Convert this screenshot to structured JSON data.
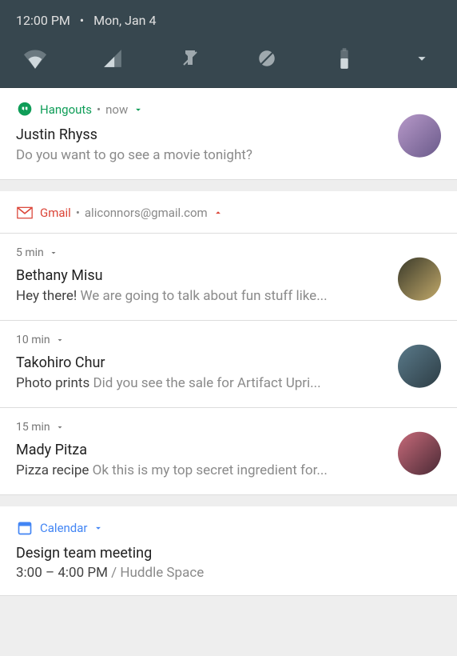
{
  "statusBar": {
    "time": "12:00 PM",
    "separator": "•",
    "date": "Mon, Jan 4"
  },
  "notifications": {
    "hangouts": {
      "appName": "Hangouts",
      "timeLabel": "now",
      "title": "Justin Rhyss",
      "body": "Do you want to go see a movie tonight?"
    },
    "gmail": {
      "appName": "Gmail",
      "account": "aliconnors@gmail.com",
      "items": [
        {
          "time": "5 min",
          "sender": "Bethany Misu",
          "subject": "Hey there!",
          "preview": "We are going to talk about fun stuff like..."
        },
        {
          "time": "10 min",
          "sender": "Takohiro Chur",
          "subject": "Photo prints",
          "preview": "Did you see the sale for Artifact Upri..."
        },
        {
          "time": "15 min",
          "sender": "Mady Pitza",
          "subject": "Pizza recipe",
          "preview": "Ok this is my top secret ingredient for..."
        }
      ]
    },
    "calendar": {
      "appName": "Calendar",
      "title": "Design team meeting",
      "timeRange": "3:00 – 4:00 PM",
      "location": "Huddle Space"
    }
  }
}
